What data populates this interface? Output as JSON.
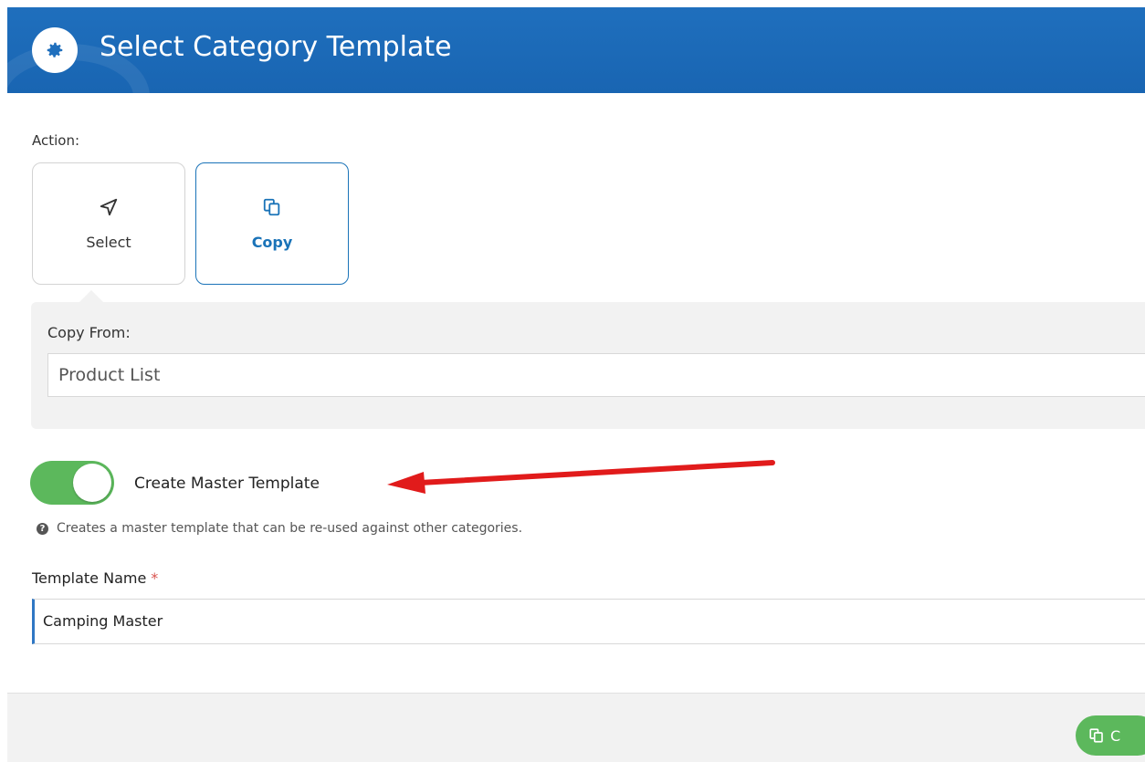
{
  "header": {
    "title": "Select Category Template",
    "icon": "gear-icon",
    "bg_color": "#1f6fbd"
  },
  "action": {
    "label": "Action:",
    "options": [
      {
        "label": "Select",
        "icon": "navigation-arrow-icon",
        "selected": false
      },
      {
        "label": "Copy",
        "icon": "copy-icon",
        "selected": true
      }
    ]
  },
  "copy_from": {
    "label": "Copy From:",
    "value": "Product List"
  },
  "master_toggle": {
    "label": "Create Master Template",
    "on": true,
    "color": "#5cb85c",
    "help_text": "Creates a master template that can be re-used against other categories."
  },
  "template_name": {
    "label": "Template Name",
    "required_mark": "*",
    "value": "Camping Master"
  },
  "footer": {
    "button_label": "C",
    "button_icon": "copy-icon"
  },
  "annotation": {
    "arrow_color": "#e11b1b"
  }
}
